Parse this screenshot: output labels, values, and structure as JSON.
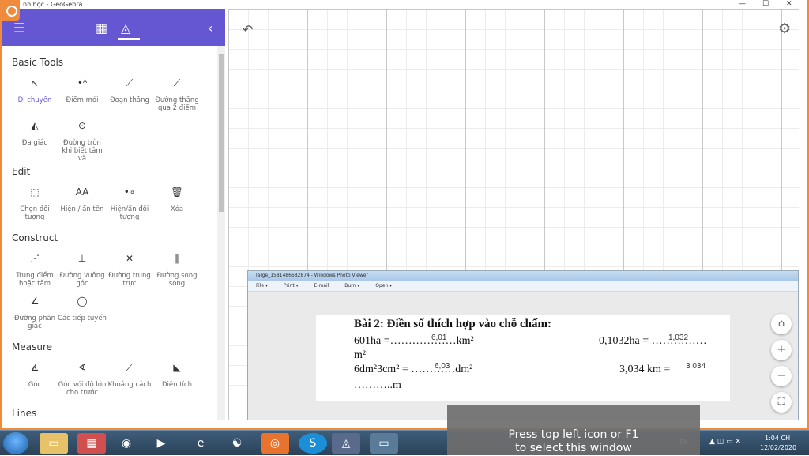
{
  "window": {
    "title": "nh học - GeoGebra",
    "minimize": "—",
    "maximize": "☐",
    "close": "✕"
  },
  "header": {
    "menu_icon": "menu-icon",
    "calculator_icon": "calculator-icon",
    "tools_icon": "tools-icon",
    "collapse_icon": "chevron-left-icon"
  },
  "sections": {
    "basic": "Basic Tools",
    "edit": "Edit",
    "construct": "Construct",
    "measure": "Measure",
    "lines": "Lines"
  },
  "tools": {
    "basic": [
      "Di chuyển",
      "Điểm mới",
      "Đoạn thẳng",
      "Đường thẳng qua 2 điểm",
      "Đa giác",
      "Đường tròn khi biết tâm và"
    ],
    "edit": [
      "Chọn đối tượng",
      "Hiện / ẩn tên",
      "Hiện/ẩn đối tượng",
      "Xóa"
    ],
    "construct": [
      "Trung điểm hoặc tâm",
      "Đường vuông góc",
      "Đường trung trực",
      "Đường song song",
      "Đường phân giác",
      "Các tiếp tuyến"
    ],
    "measure": [
      "Góc",
      "Góc với độ lớn cho trước",
      "Khoảng cách",
      "Diện tích"
    ]
  },
  "graphics": {
    "undo": "↶",
    "settings": "⚙",
    "home": "⌂",
    "zoom_in": "+",
    "zoom_out": "−",
    "fullscreen": "⛶"
  },
  "photo_viewer": {
    "title": "large_1581486682874 - Windows Photo Viewer",
    "menu": [
      "File ▾",
      "Print ▾",
      "E-mail",
      "Burn ▾",
      "Open ▾"
    ],
    "doc": {
      "heading": "Bài 2: Điền số thích hợp vào chỗ chấm:",
      "l1a": "601ha =………………km²",
      "l1a_hw": "6,01",
      "l1b": "0,1032ha = ……………",
      "l1b_hw": "1,032",
      "l2": "m²",
      "l3a": "6dm²3cm² = …………dm²",
      "l3a_hw": "6,03",
      "l3b": "3,034 km =",
      "l3b_hw": "3 034",
      "l4": "………..m"
    }
  },
  "tooltip": {
    "line1": "Press top left icon or F1",
    "line2": "to select this window"
  },
  "taskbar": {
    "lang": "EN",
    "time": "1:04 CH",
    "date": "12/02/2020"
  }
}
